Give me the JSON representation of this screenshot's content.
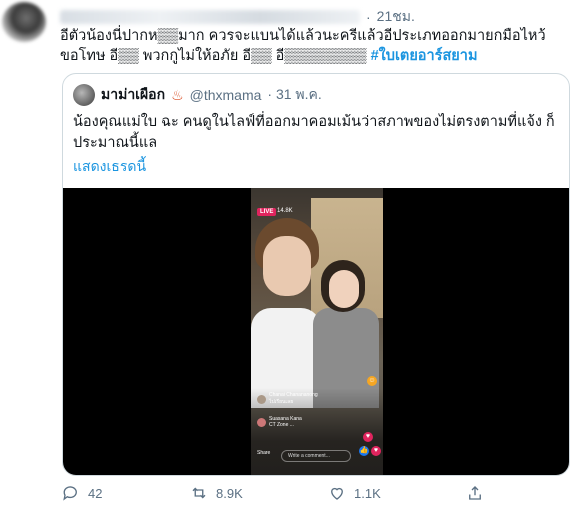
{
  "tweet": {
    "time": "21ชม.",
    "text_line1": "อีตัวน้องนี่ปากห▒▒มาก ควรจะแบนได้แล้วนะครีแล้วอีประเภทออกมายกมือไหว้",
    "text_line2": "ขอโทษ อี▒▒ พวกกูไม่ให้อภัย อี▒▒ อี▒▒▒▒▒▒▒▒",
    "hashtag": "#ใบเตยอาร์สยาม"
  },
  "quoted": {
    "name": "มาม่าเผือก",
    "name_icon": "hot-springs-icon",
    "handle": "@thxmama",
    "date": "· 31 พ.ค.",
    "text": "น้องคุณแม่ใบ ฉะ คนดูในไลฟ์ที่ออกมาคอมเม้นว่าสภาพของไม่ตรงตามที่แจ้ง ก็ประมาณนี้แล",
    "show_thread": "แสดงเธรดนี้"
  },
  "live": {
    "badge": "LIVE",
    "viewers": "14.8K",
    "comment1": "Chanai Chanananong",
    "comment1_text": "ไปเรียนเลย",
    "comment2": "Suasana Kana",
    "comment2_text": "CT Zone ...",
    "input_placeholder": "Write a comment...",
    "share": "Share"
  },
  "actions": {
    "reply_count": "42",
    "retweet_count": "8.9K",
    "like_count": "1.1K"
  },
  "colors": {
    "accent": "#1b95e0",
    "secondary_text": "#5b7083",
    "border": "#cfd9de"
  }
}
